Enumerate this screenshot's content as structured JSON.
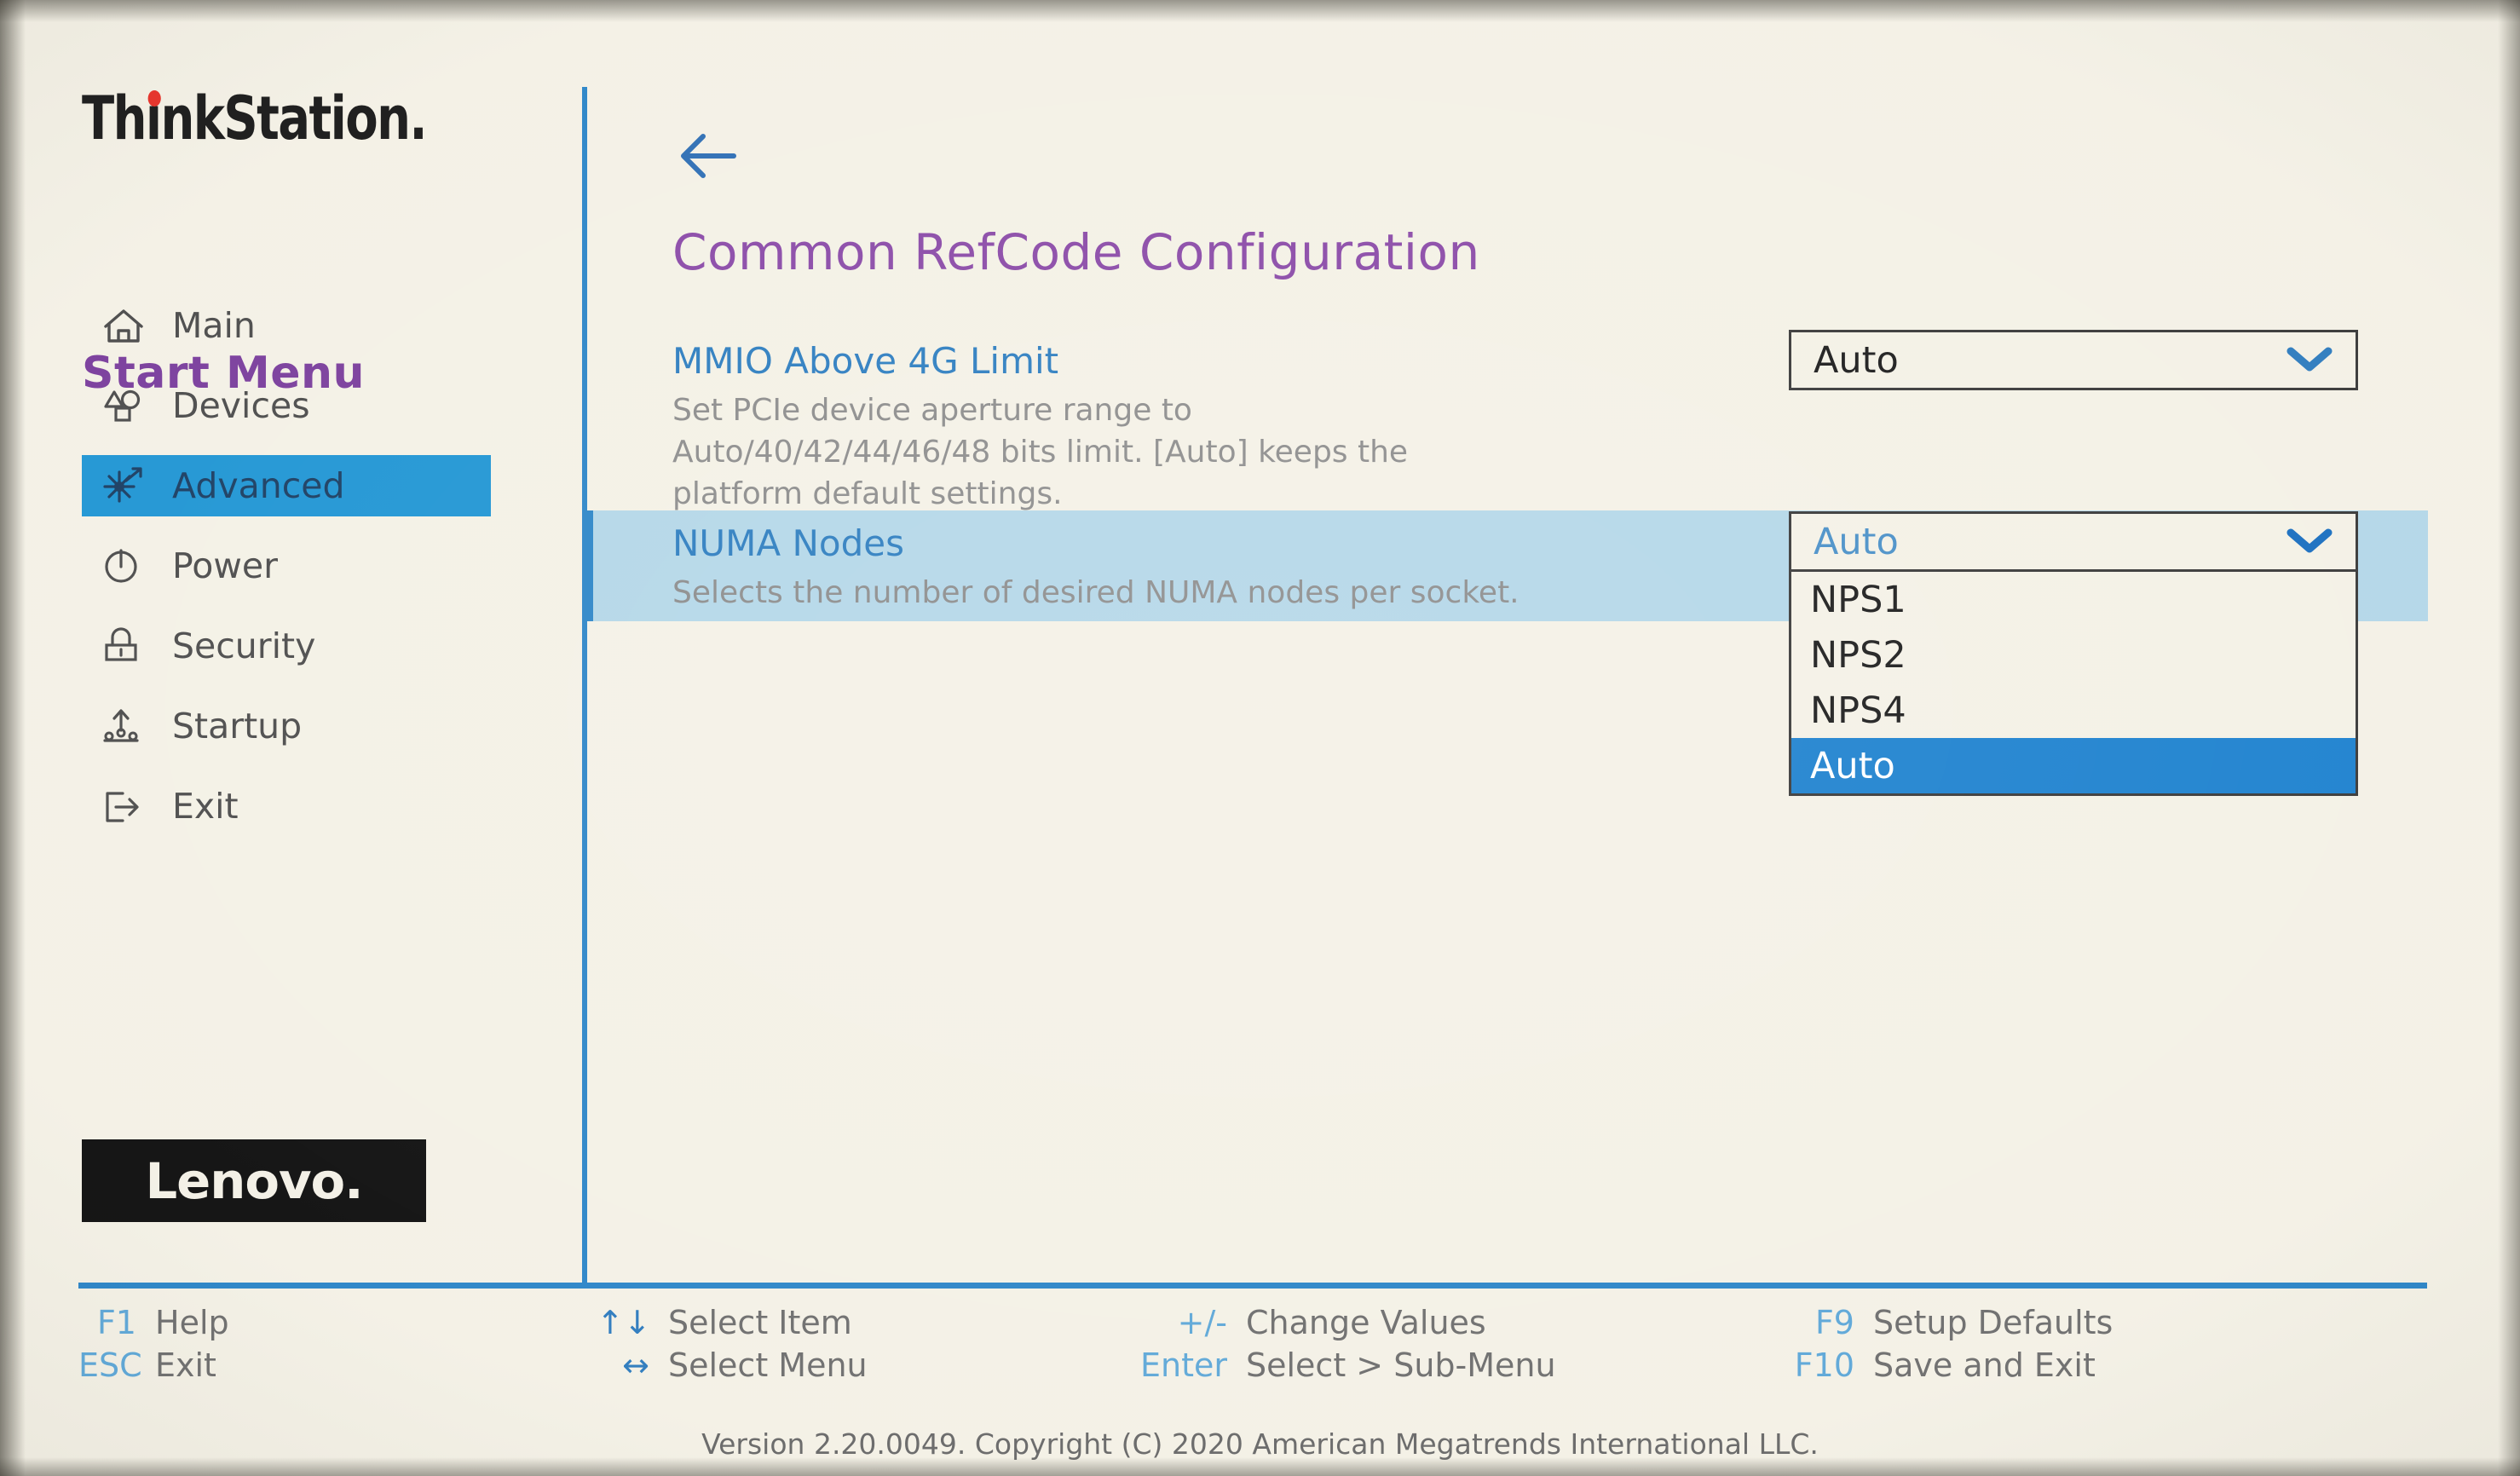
{
  "brand": {
    "thinkstation_part1": "Th",
    "thinkstation_part2": "i",
    "thinkstation_part3": "nkStation.",
    "lenovo": "Lenovo."
  },
  "sidebar": {
    "title": "Start Menu",
    "items": [
      {
        "label": "Main",
        "icon": "home-icon",
        "selected": false
      },
      {
        "label": "Devices",
        "icon": "shapes-icon",
        "selected": false
      },
      {
        "label": "Advanced",
        "icon": "asterisk-arrow-icon",
        "selected": true
      },
      {
        "label": "Power",
        "icon": "power-icon",
        "selected": false
      },
      {
        "label": "Security",
        "icon": "lock-icon",
        "selected": false
      },
      {
        "label": "Startup",
        "icon": "startup-icon",
        "selected": false
      },
      {
        "label": "Exit",
        "icon": "exit-icon",
        "selected": false
      }
    ]
  },
  "main": {
    "back_icon": "back-arrow-icon",
    "title": "Common RefCode Configuration",
    "settings": [
      {
        "label": "MMIO Above 4G Limit",
        "description": "Set PCIe device aperture range to Auto/40/42/44/46/48 bits limit. [Auto] keeps the platform default settings.",
        "desc_line1": "Set PCIe device aperture range to",
        "desc_line2": "Auto/40/42/44/46/48 bits limit. [Auto] keeps the",
        "desc_line3": "platform default settings.",
        "value": "Auto",
        "highlighted": false,
        "expanded": false
      },
      {
        "label": "NUMA Nodes",
        "description": "Selects the number of desired NUMA nodes per socket.",
        "desc_line1": "Selects the number of desired NUMA nodes per socket.",
        "value": "Auto",
        "highlighted": true,
        "expanded": true,
        "options": [
          "NPS1",
          "NPS2",
          "NPS4",
          "Auto"
        ],
        "selected_option": "Auto"
      }
    ]
  },
  "footer": {
    "hints": [
      {
        "key": "F1",
        "label": "Help"
      },
      {
        "key": "ESC",
        "label": "Exit"
      },
      {
        "key": "↑↓",
        "label": "Select Item"
      },
      {
        "key": "↔",
        "label": "Select Menu"
      },
      {
        "key": "+/-",
        "label": "Change Values"
      },
      {
        "key": "Enter",
        "label": "Select > Sub-Menu"
      },
      {
        "key": "F9",
        "label": "Setup Defaults"
      },
      {
        "key": "F10",
        "label": "Save and Exit"
      }
    ],
    "version": "Version 2.20.0049. Copyright (C) 2020 American Megatrends International LLC."
  },
  "colors": {
    "background": "#f4f1e6",
    "accent_blue": "#2196d4",
    "rule_blue": "#2d86c8",
    "purple_title": "#8b4ba8",
    "purple_menu": "#7b3f9d",
    "label_blue": "#2e7ec0",
    "desc_gray": "#8d8d8d",
    "highlight_row": "#b4d7e8",
    "option_selected": "#1e82cf",
    "lenovo_red": "#e8332a"
  }
}
